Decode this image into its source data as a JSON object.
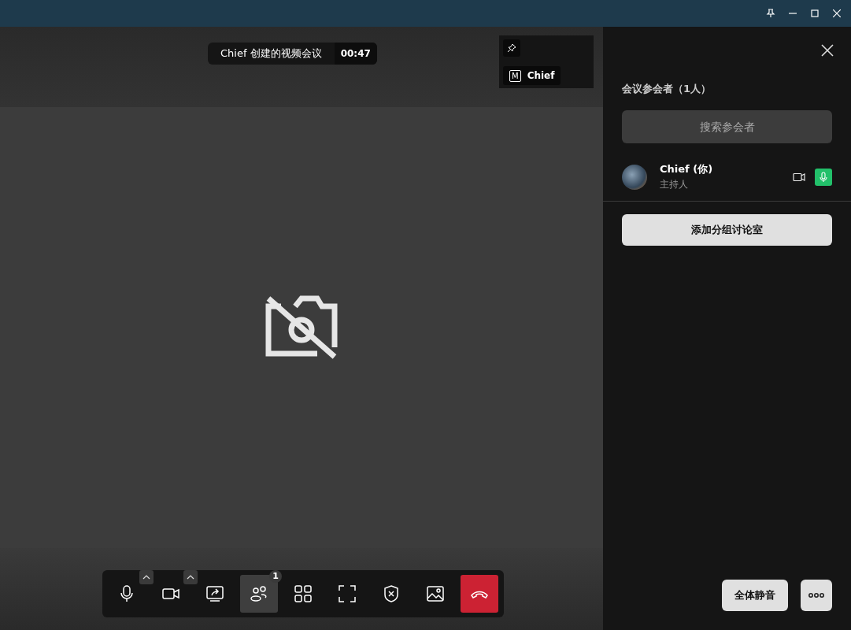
{
  "meeting": {
    "title": "Chief 创建的视频会议",
    "timer": "00:47"
  },
  "thumbnail": {
    "name_initial": "M",
    "name": "Chief",
    "pinned": true
  },
  "toolbar": [
    {
      "kind": "mic",
      "selected": false,
      "caret": true
    },
    {
      "kind": "camera",
      "selected": false,
      "caret": true
    },
    {
      "kind": "share",
      "selected": false,
      "caret": false
    },
    {
      "kind": "participants",
      "selected": true,
      "caret": false,
      "badge": "1"
    },
    {
      "kind": "grid",
      "selected": false,
      "caret": false
    },
    {
      "kind": "fullscreen",
      "selected": false,
      "caret": false
    },
    {
      "kind": "security",
      "selected": false,
      "caret": false
    },
    {
      "kind": "background",
      "selected": false,
      "caret": false
    },
    {
      "kind": "hangup",
      "selected": false,
      "caret": false
    }
  ],
  "panel": {
    "heading": "会议参会者（1人）",
    "search": {
      "placeholder": "搜索参会者"
    },
    "participants": [
      {
        "name": "Chief (你)",
        "role": "主持人",
        "camera_on": false,
        "mic_on": true
      }
    ],
    "breakout_button": "添加分组讨论室",
    "mute_all_button": "全体静音"
  }
}
